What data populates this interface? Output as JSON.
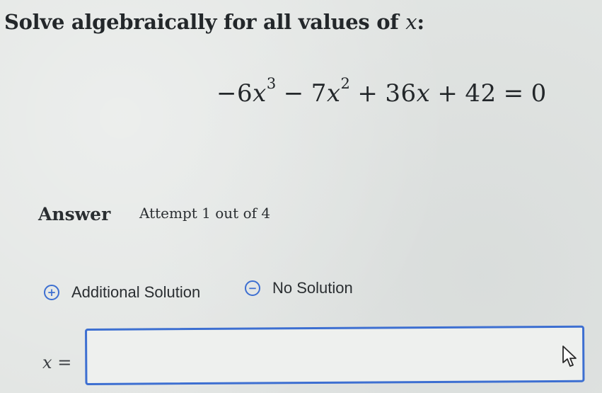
{
  "question": {
    "prompt": "Solve algebraically for all values of ",
    "variable": "x",
    "colon": ":"
  },
  "equation": {
    "neg_coef": "−6",
    "v1": "x",
    "e1": "3",
    "op1": "−",
    "coef2": "7",
    "v2": "x",
    "e2": "2",
    "op2": "+",
    "coef3": "36",
    "v3": "x",
    "op3": "+",
    "const": "42",
    "eq": "=",
    "rhs": "0"
  },
  "answer": {
    "label": "Answer",
    "attempt": "Attempt 1 out of 4"
  },
  "options": {
    "add_solution": "Additional Solution",
    "no_solution": "No Solution"
  },
  "input": {
    "variable": "x",
    "equals": "=",
    "value": ""
  },
  "colors": {
    "accent": "#3d6fd1",
    "text": "#23272a",
    "background": "#e2e5e3"
  },
  "icons": {
    "add": "plus-circle-icon",
    "remove": "minus-circle-icon",
    "cursor": "mouse-pointer-icon"
  }
}
